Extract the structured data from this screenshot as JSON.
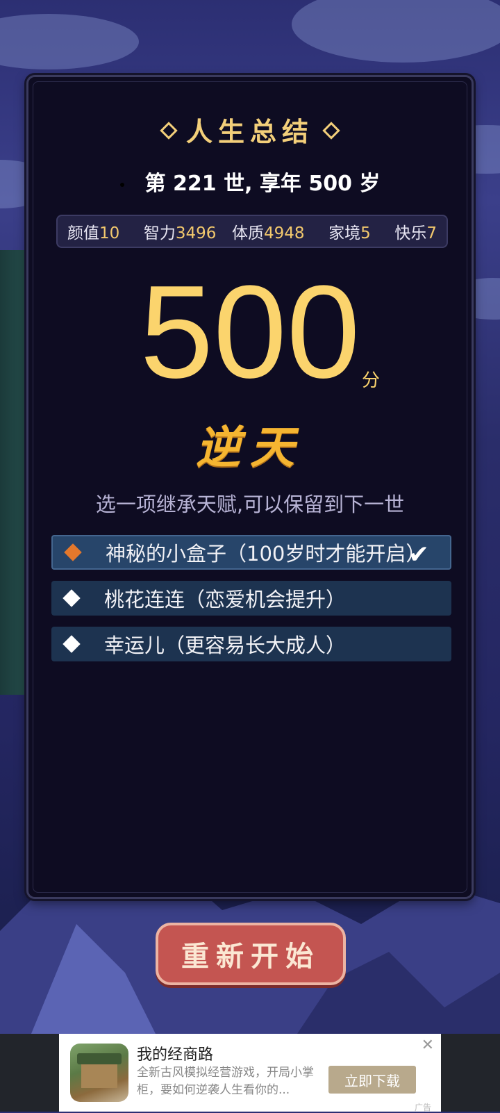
{
  "summary": {
    "title": "人生总结",
    "life_line": "第 221 世, 享年 500 岁"
  },
  "stats": [
    {
      "label": "颜值",
      "value": "10"
    },
    {
      "label": "智力",
      "value": "3496"
    },
    {
      "label": "体质",
      "value": "4948"
    },
    {
      "label": "家境",
      "value": "5"
    },
    {
      "label": "快乐",
      "value": "7"
    }
  ],
  "score": {
    "value": "500",
    "unit": "分",
    "rank": "逆天"
  },
  "inherit_prompt": "选一项继承天赋,可以保留到下一世",
  "talents": [
    {
      "label": "神秘的小盒子（100岁时才能开启）",
      "selected": true
    },
    {
      "label": "桃花连连（恋爱机会提升）",
      "selected": false
    },
    {
      "label": "幸运儿（更容易长大成人）",
      "selected": false
    }
  ],
  "restart_label": "重新开始",
  "ad": {
    "title": "我的经商路",
    "description": "全新古风模拟经营游戏，开局小掌柜，要如何逆袭人生看你的...",
    "button": "立即下载",
    "close": "✕",
    "tag": "广告"
  },
  "colors": {
    "accent": "#fbd46d",
    "panel": "#0e0c22",
    "restart": "#c45551"
  }
}
